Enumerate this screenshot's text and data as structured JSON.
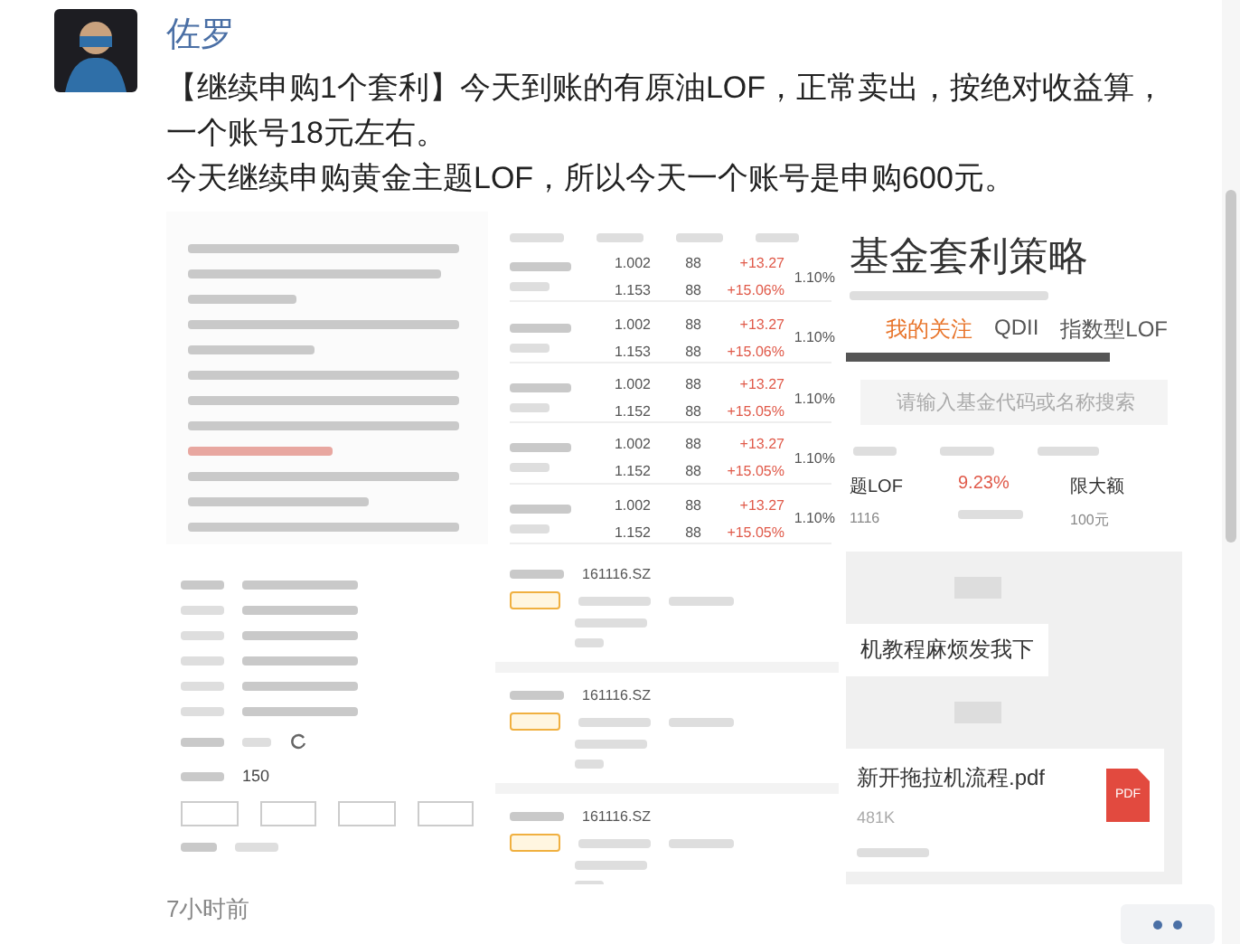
{
  "author": {
    "name": "佐罗"
  },
  "post": {
    "lines": [
      "【继续申购1个套利】今天到账的有原油LOF，正常卖出，按绝对收益算，",
      "一个账号18元左右。",
      "今天继续申购黄金主题LOF，所以今天一个账号是申购600元。"
    ]
  },
  "images": [
    {
      "kind": "document"
    },
    {
      "kind": "table",
      "rows": [
        {
          "price": "1.002",
          "nav": "1.153",
          "count_a": "88",
          "count_b": "88",
          "change": "+13.27",
          "premium": "+15.06%",
          "rate": "1.10%"
        },
        {
          "price": "1.002",
          "nav": "1.153",
          "count_a": "88",
          "count_b": "88",
          "change": "+13.27",
          "premium": "+15.06%",
          "rate": "1.10%"
        },
        {
          "price": "1.002",
          "nav": "1.152",
          "count_a": "88",
          "count_b": "88",
          "change": "+13.27",
          "premium": "+15.05%",
          "rate": "1.10%"
        },
        {
          "price": "1.002",
          "nav": "1.152",
          "count_a": "88",
          "count_b": "88",
          "change": "+13.27",
          "premium": "+15.05%",
          "rate": "1.10%"
        },
        {
          "price": "1.002",
          "nav": "1.152",
          "count_a": "88",
          "count_b": "88",
          "change": "+13.27",
          "premium": "+15.05%",
          "rate": "1.10%"
        }
      ]
    },
    {
      "kind": "fund_app",
      "title": "基金套利策略",
      "tabs": [
        {
          "label": "我的关注",
          "selected": true
        },
        {
          "label": "QDII",
          "selected": false
        },
        {
          "label": "指数型LOF",
          "selected": false
        }
      ],
      "search": {
        "placeholder": "请输入基金代码或名称搜索"
      },
      "row": {
        "name": "题LOF",
        "code": "1116",
        "rate": "9.23%",
        "status": "限大额",
        "amount": "100元"
      }
    },
    {
      "kind": "form",
      "amount": "150"
    },
    {
      "kind": "orders",
      "cards": [
        {
          "code": "161116.SZ"
        },
        {
          "code": "161116.SZ"
        },
        {
          "code": "161116.SZ"
        }
      ]
    },
    {
      "kind": "chat",
      "message": "机教程麻烦发我下",
      "file": {
        "name": "新开拖拉机流程.pdf",
        "size": "481K",
        "badge": "PDF"
      }
    }
  ],
  "time": "7小时前"
}
